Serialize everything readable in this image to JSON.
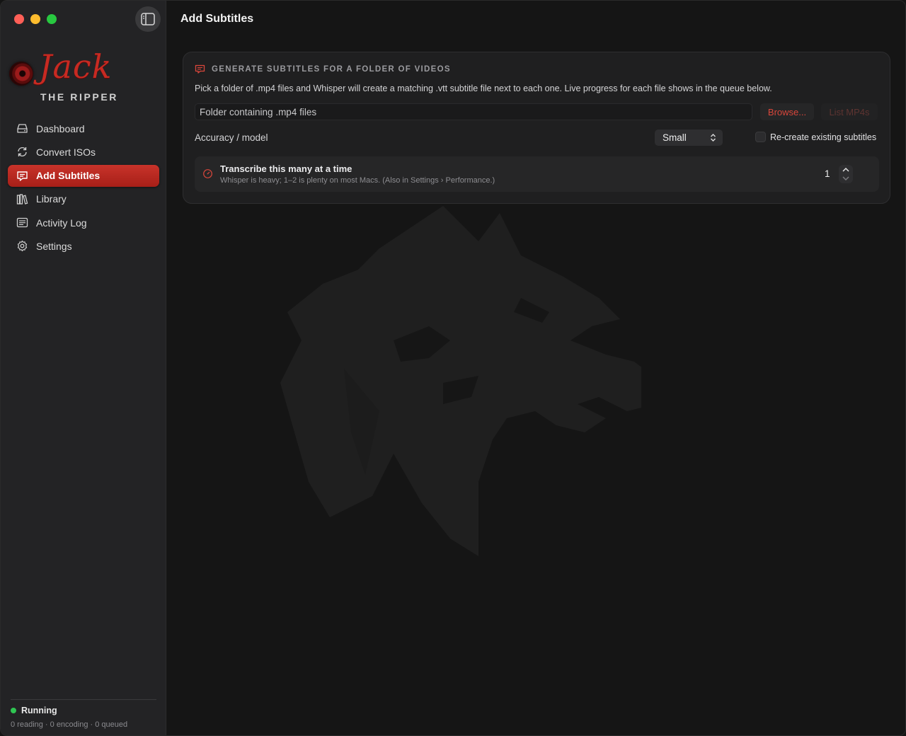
{
  "app": {
    "logo_word": "Jack",
    "logo_sub": "THE RIPPER"
  },
  "sidebar": {
    "items": [
      {
        "label": "Dashboard",
        "icon": "drive-icon"
      },
      {
        "label": "Convert ISOs",
        "icon": "refresh-icon"
      },
      {
        "label": "Add Subtitles",
        "icon": "captions-icon",
        "active": true
      },
      {
        "label": "Library",
        "icon": "library-icon"
      },
      {
        "label": "Activity Log",
        "icon": "log-icon"
      },
      {
        "label": "Settings",
        "icon": "gear-icon"
      }
    ],
    "status": {
      "label": "Running",
      "detail": "0 reading · 0 encoding · 0 queued"
    }
  },
  "main": {
    "title": "Add Subtitles",
    "card": {
      "heading": "GENERATE SUBTITLES FOR A FOLDER OF VIDEOS",
      "description": "Pick a folder of .mp4 files and Whisper will create a matching .vtt subtitle file next to each one. Live progress for each file shows in the queue below.",
      "folder_placeholder": "Folder containing .mp4 files",
      "folder_value": "",
      "browse_label": "Browse...",
      "list_label": "List MP4s",
      "model_label": "Accuracy / model",
      "model_value": "Small",
      "recreate_label": "Re-create existing subtitles",
      "recreate_checked": false,
      "concurrency": {
        "title": "Transcribe this many at a time",
        "description": "Whisper is heavy; 1–2 is plenty on most Macs. (Also in Settings › Performance.)",
        "value": "1"
      }
    }
  },
  "colors": {
    "accent": "#c8332a",
    "accent_text": "#d9463b",
    "status_ok": "#2fc552"
  }
}
